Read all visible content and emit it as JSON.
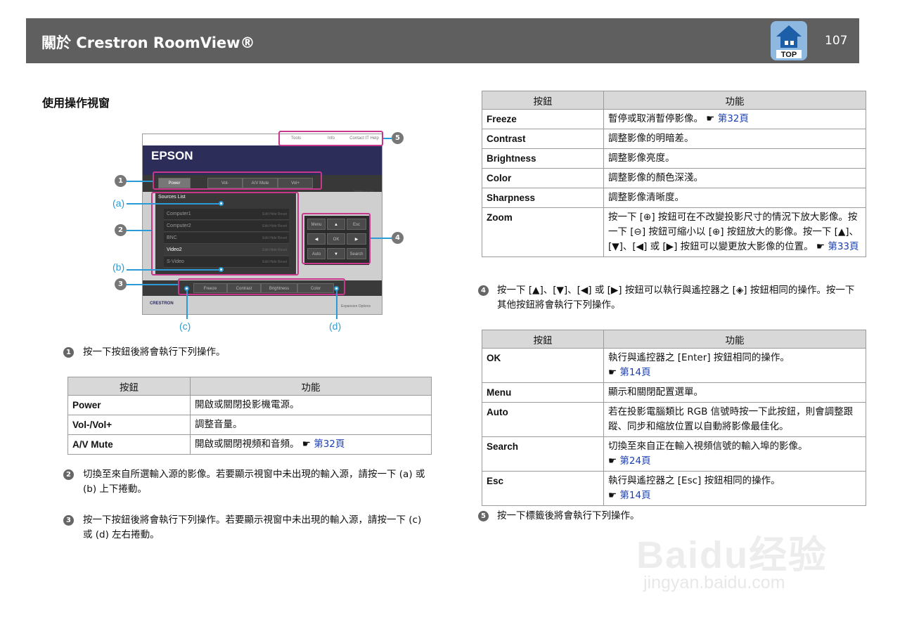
{
  "header": {
    "title": "關於 Crestron RoomView®",
    "page_number": "107",
    "top_label": "TOP"
  },
  "section_title": "使用操作視窗",
  "diagram": {
    "tabs": [
      "Tools",
      "Info",
      "Contact IT Help"
    ],
    "brand": "EPSON",
    "top_buttons": [
      "Power",
      "Vol-",
      "A/V Mute",
      "Vol+"
    ],
    "version": "Interface 2.7.2.0",
    "sources_title": "Sources List",
    "sources": [
      "Computer1",
      "Computer2",
      "BNC",
      "Video2",
      "S-Video"
    ],
    "source_actions": "Edit  Hide  Reset",
    "nav_buttons": [
      "Menu",
      "▲",
      "Esc",
      "◀",
      "OK",
      "▶",
      "Auto",
      "▼",
      "Search"
    ],
    "bottom_buttons": [
      "Freeze",
      "Contrast",
      "Brightness",
      "Color"
    ],
    "crestron": "CRESTRON",
    "expansion": "Expansion Options",
    "callouts": {
      "a": "(a)",
      "b": "(b)",
      "c": "(c)",
      "d": "(d)"
    },
    "circle_numbers": [
      "1",
      "2",
      "3",
      "4",
      "5"
    ]
  },
  "note1": "按一下按鈕後將會執行下列操作。",
  "table1": {
    "headers": [
      "按鈕",
      "功能"
    ],
    "rows": [
      {
        "button": "Power",
        "func": "開啟或關閉投影機電源。",
        "link": ""
      },
      {
        "button": "Vol-/Vol+",
        "func": "調整音量。",
        "link": ""
      },
      {
        "button": "A/V Mute",
        "func": "開啟或關閉視頻和音頻。 ",
        "link": "第32頁"
      }
    ]
  },
  "note2": "切換至來自所選輸入源的影像。若要顯示視窗中未出現的輸入源，請按一下 (a) 或 (b) 上下捲動。",
  "note3": "按一下按鈕後將會執行下列操作。若要顯示視窗中未出現的輸入源，請按一下 (c) 或 (d) 左右捲動。",
  "table2": {
    "headers": [
      "按鈕",
      "功能"
    ],
    "rows": [
      {
        "button": "Freeze",
        "func": "暫停或取消暫停影像。 ",
        "link": "第32頁"
      },
      {
        "button": "Contrast",
        "func": "調整影像的明暗差。",
        "link": ""
      },
      {
        "button": "Brightness",
        "func": "調整影像亮度。",
        "link": ""
      },
      {
        "button": "Color",
        "func": "調整影像的顏色深淺。",
        "link": ""
      },
      {
        "button": "Sharpness",
        "func": "調整影像清晰度。",
        "link": ""
      },
      {
        "button": "Zoom",
        "func": "按一下 [⊕] 按鈕可在不改變投影尺寸的情況下放大影像。按一下 [⊖] 按鈕可縮小以 [⊕] 按鈕放大的影像。按一下 [▲]、[▼]、[◀] 或 [▶] 按鈕可以變更放大影像的位置。 ",
        "link": "第33頁"
      }
    ]
  },
  "note4": "按一下 [▲]、[▼]、[◀] 或 [▶] 按鈕可以執行與遙控器之 [◈] 按鈕相同的操作。按一下其他按鈕將會執行下列操作。",
  "table3": {
    "headers": [
      "按鈕",
      "功能"
    ],
    "rows": [
      {
        "button": "OK",
        "func": "執行與遙控器之 [Enter] 按鈕相同的操作。",
        "link": "第14頁"
      },
      {
        "button": "Menu",
        "func": "顯示和關閉配置選單。",
        "link": ""
      },
      {
        "button": "Auto",
        "func": "若在投影電腦類比 RGB 信號時按一下此按鈕，則會調整跟蹤、同步和縮放位置以自動將影像最佳化。",
        "link": ""
      },
      {
        "button": "Search",
        "func": "切換至來自正在輸入視頻信號的輸入埠的影像。",
        "link": "第24頁"
      },
      {
        "button": "Esc",
        "func": "執行與遙控器之 [Esc] 按鈕相同的操作。",
        "link": "第14頁"
      }
    ]
  },
  "note5": "按一下標籤後將會執行下列操作。",
  "hand_glyph": "☛",
  "watermark": {
    "line1": "Baidu经验",
    "line2": "jingyan.baidu.com"
  }
}
